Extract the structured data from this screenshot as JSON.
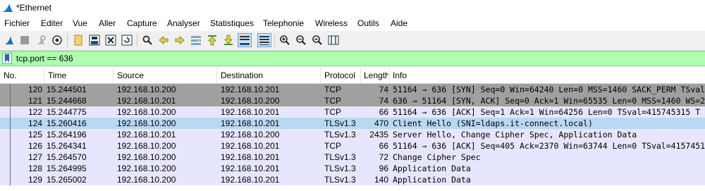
{
  "window": {
    "title": "*Ethernet"
  },
  "menu": [
    "Fichier",
    "Editer",
    "Vue",
    "Aller",
    "Capture",
    "Analyser",
    "Statistiques",
    "Telephonie",
    "Wireless",
    "Outils",
    "Aide"
  ],
  "toolbar": {
    "icons": [
      "shark-fin-start-icon",
      "stop-square-icon",
      "restart-capture-icon",
      "capture-options-gear-icon",
      "open-file-icon",
      "save-file-icon",
      "close-file-icon",
      "reload-file-icon",
      "find-packet-icon",
      "go-back-arrow-icon",
      "go-forward-arrow-icon",
      "go-to-packet-icon",
      "first-packet-icon",
      "last-packet-icon",
      "auto-scroll-icon",
      "colorize-icon",
      "zoom-in-icon",
      "zoom-out-icon",
      "normal-size-icon",
      "resize-columns-icon"
    ]
  },
  "filter": {
    "value": "tcp.port == 636"
  },
  "columns": [
    "No.",
    "Time",
    "Source",
    "Destination",
    "Protocol",
    "Length",
    "Info"
  ],
  "colors": {
    "selected_dark": "#a0a0a0",
    "tcp_row": "#e7e6ff",
    "highlight": "#b8d8f4",
    "filter_bg": "#afffaf"
  },
  "packets": [
    {
      "no": "120",
      "time": "15.244501",
      "src": "192.168.10.200",
      "dst": "192.168.10.201",
      "proto": "TCP",
      "len": "74",
      "info": "51164 → 636 [SYN] Seq=0 Win=64240 Len=0 MSS=1460 SACK_PERM TSval"
    },
    {
      "no": "121",
      "time": "15.244668",
      "src": "192.168.10.201",
      "dst": "192.168.10.200",
      "proto": "TCP",
      "len": "74",
      "info": "636 → 51164 [SYN, ACK] Seq=0 Ack=1 Win=65535 Len=0 MSS=1460 WS=2"
    },
    {
      "no": "122",
      "time": "15.244775",
      "src": "192.168.10.200",
      "dst": "192.168.10.201",
      "proto": "TCP",
      "len": "66",
      "info": "51164 → 636 [ACK] Seq=1 Ack=1 Win=64256 Len=0 TSval=415745315 T"
    },
    {
      "no": "124",
      "time": "15.260416",
      "src": "192.168.10.200",
      "dst": "192.168.10.201",
      "proto": "TLSv1.3",
      "len": "470",
      "info": "Client Hello (SNI=ldaps.it-connect.local)"
    },
    {
      "no": "125",
      "time": "15.264196",
      "src": "192.168.10.201",
      "dst": "192.168.10.200",
      "proto": "TLSv1.3",
      "len": "2435",
      "info": "Server Hello, Change Cipher Spec, Application Data"
    },
    {
      "no": "126",
      "time": "15.264341",
      "src": "192.168.10.200",
      "dst": "192.168.10.201",
      "proto": "TCP",
      "len": "66",
      "info": "51164 → 636 [ACK] Seq=405 Ack=2370 Win=63744 Len=0 TSval=4157451"
    },
    {
      "no": "127",
      "time": "15.264570",
      "src": "192.168.10.200",
      "dst": "192.168.10.201",
      "proto": "TLSv1.3",
      "len": "72",
      "info": "Change Cipher Spec"
    },
    {
      "no": "128",
      "time": "15.264995",
      "src": "192.168.10.200",
      "dst": "192.168.10.201",
      "proto": "TLSv1.3",
      "len": "96",
      "info": "Application Data"
    },
    {
      "no": "129",
      "time": "15.265002",
      "src": "192.168.10.200",
      "dst": "192.168.10.201",
      "proto": "TLSv1.3",
      "len": "140",
      "info": "Application Data"
    }
  ]
}
